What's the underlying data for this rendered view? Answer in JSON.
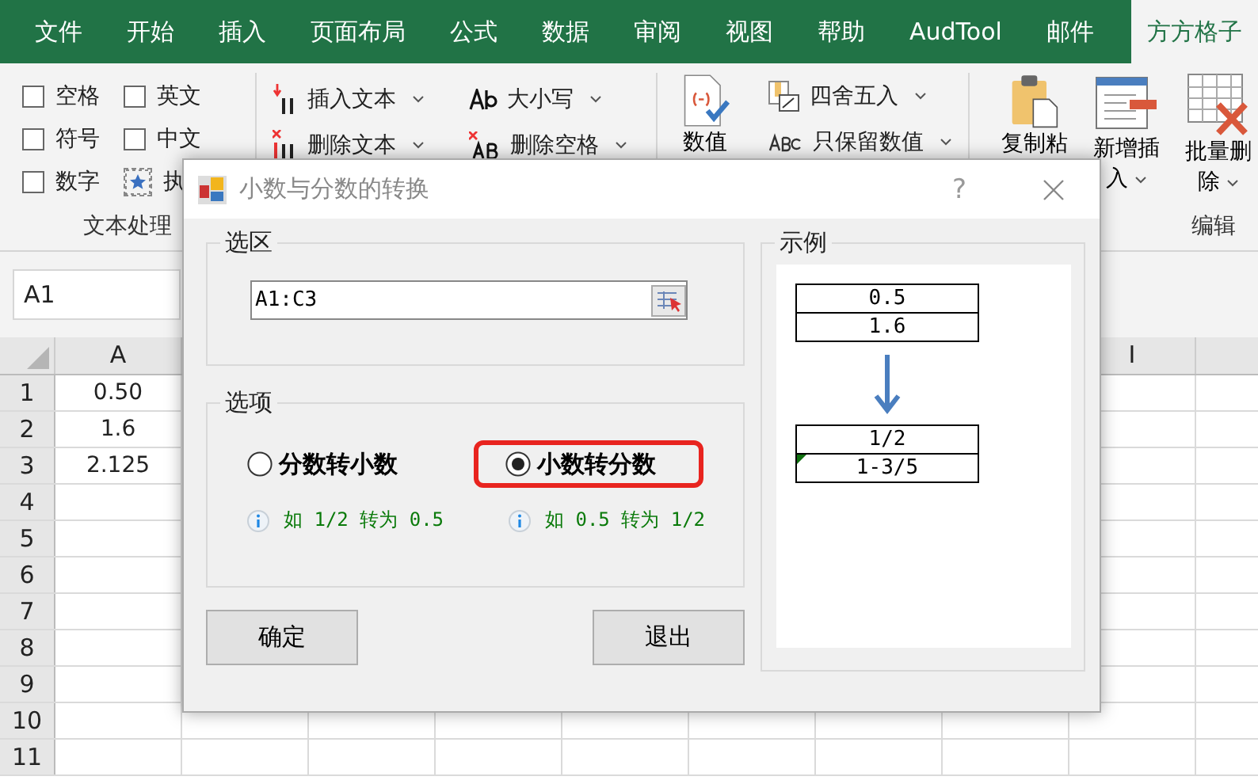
{
  "ribbon_tabs": [
    {
      "label": "文件",
      "selected": false
    },
    {
      "label": "开始",
      "selected": false
    },
    {
      "label": "插入",
      "selected": false
    },
    {
      "label": "页面布局",
      "selected": false
    },
    {
      "label": "公式",
      "selected": false
    },
    {
      "label": "数据",
      "selected": false
    },
    {
      "label": "审阅",
      "selected": false
    },
    {
      "label": "视图",
      "selected": false
    },
    {
      "label": "帮助",
      "selected": false
    },
    {
      "label": "AudTool",
      "selected": false
    },
    {
      "label": "邮件",
      "selected": false
    },
    {
      "label": "方方格子",
      "selected": true
    }
  ],
  "ribbon": {
    "text_group": {
      "checkboxes": [
        {
          "label": "空格",
          "checked": false
        },
        {
          "label": "英文",
          "checked": false
        },
        {
          "label": "符号",
          "checked": false
        },
        {
          "label": "中文",
          "checked": false
        },
        {
          "label": "数字",
          "checked": false
        }
      ],
      "star_button": "执",
      "label": "文本处理"
    },
    "text_tools": [
      {
        "kind": "insert",
        "label": "插入文本"
      },
      {
        "kind": "delete",
        "label": "删除文本"
      },
      {
        "kind": "case",
        "label": "大小写"
      },
      {
        "kind": "trim",
        "label": "删除空格"
      }
    ],
    "number_group": {
      "big_button": "数值",
      "items": [
        {
          "kind": "round",
          "label": "四舍五入"
        },
        {
          "kind": "keep",
          "label": "只保留数值"
        }
      ]
    },
    "edit_group": {
      "buttons": [
        {
          "kind": "paste",
          "lines": [
            "复制粘"
          ],
          "menu": false
        },
        {
          "kind": "insert",
          "lines": [
            "新增插",
            "入"
          ],
          "menu": true
        },
        {
          "kind": "delete",
          "lines": [
            "批量删",
            "除"
          ],
          "menu": true
        }
      ],
      "label": "编辑"
    }
  },
  "name_box": "A1",
  "columns": [
    "A",
    "I"
  ],
  "rows": [
    {
      "number": "1",
      "a": "0.50"
    },
    {
      "number": "2",
      "a": "1.6"
    },
    {
      "number": "3",
      "a": "2.125"
    },
    {
      "number": "4",
      "a": ""
    },
    {
      "number": "5",
      "a": ""
    },
    {
      "number": "6",
      "a": ""
    },
    {
      "number": "7",
      "a": ""
    },
    {
      "number": "8",
      "a": ""
    },
    {
      "number": "9",
      "a": ""
    },
    {
      "number": "10",
      "a": ""
    },
    {
      "number": "11",
      "a": ""
    }
  ],
  "dialog": {
    "title": "小数与分数的转换",
    "help": "?",
    "selection": {
      "legend": "选区",
      "value": "A1:C3"
    },
    "options": {
      "legend": "选项",
      "items": [
        {
          "label": "分数转小数",
          "selected": false,
          "highlighted": false,
          "hint": "如 1/2 转为 0.5"
        },
        {
          "label": "小数转分数",
          "selected": true,
          "highlighted": true,
          "hint": "如 0.5 转为 1/2"
        }
      ]
    },
    "buttons": [
      "确定",
      "退出"
    ],
    "example": {
      "legend": "示例",
      "before": [
        "0.5",
        "1.6"
      ],
      "after": [
        {
          "text": "1/2",
          "text_indicator": false
        },
        {
          "text": "1-3/5",
          "text_indicator": true
        }
      ]
    }
  }
}
